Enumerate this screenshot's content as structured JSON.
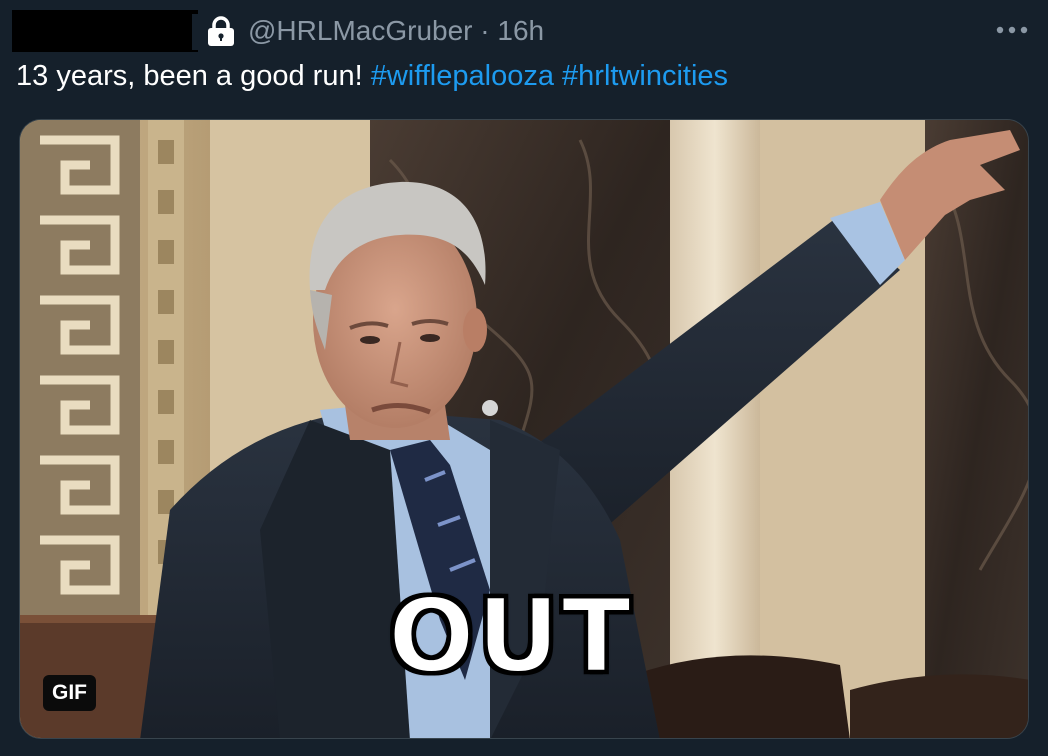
{
  "header": {
    "handle": "@HRLMacGruber",
    "separator": "·",
    "time": "16h"
  },
  "tweet": {
    "text": "13 years, been a good run!",
    "hashtags": [
      "#wifflepalooza",
      "#hrltwincities"
    ]
  },
  "media": {
    "caption": "OUT",
    "badge": "GIF"
  },
  "icons": {
    "protected": "lock-icon",
    "more": "more-icon"
  },
  "colors": {
    "background": "#15202b",
    "secondary_text": "#8b98a5",
    "hashtag": "#1d9bf0"
  }
}
